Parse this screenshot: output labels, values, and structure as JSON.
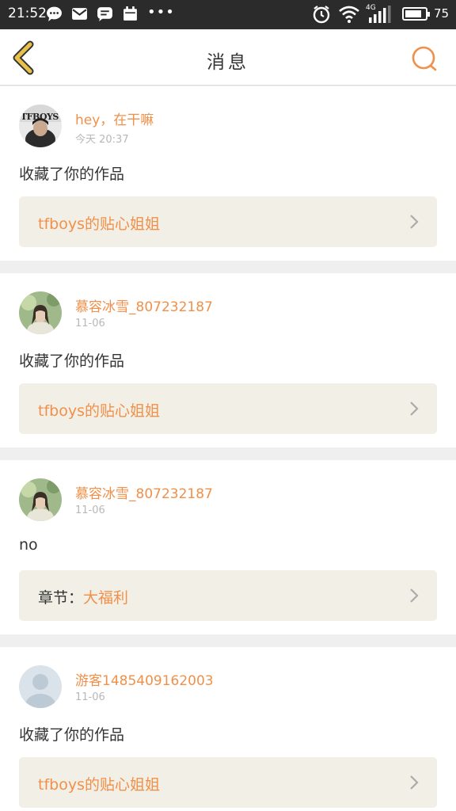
{
  "status_bar": {
    "time": "21:52",
    "network": "4G",
    "battery": "75",
    "battery_level": 0.75
  },
  "nav": {
    "title": "消息",
    "back_icon": "chevron-left-icon",
    "search_icon": "search-icon",
    "accent": "#f0904a",
    "back_color": "#e8c14a"
  },
  "messages": [
    {
      "username": "hey，在干嘛",
      "time": "今天 20:37",
      "action": "收藏了你的作品",
      "work_prefix": "",
      "work_title": "tfboys的贴心姐姐",
      "avatar": "avatar-tfboys"
    },
    {
      "username": "慕容冰雪_807232187",
      "time": "11-06",
      "action": "收藏了你的作品",
      "work_prefix": "",
      "work_title": "tfboys的贴心姐姐",
      "avatar": "avatar-girl"
    },
    {
      "username": "慕容冰雪_807232187",
      "time": "11-06",
      "action": "no",
      "work_prefix": "章节：",
      "work_title": "大福利",
      "avatar": "avatar-girl"
    },
    {
      "username": "游客1485409162003",
      "time": "11-06",
      "action": "收藏了你的作品",
      "work_prefix": "",
      "work_title": "tfboys的贴心姐姐",
      "avatar": "avatar-default"
    }
  ]
}
